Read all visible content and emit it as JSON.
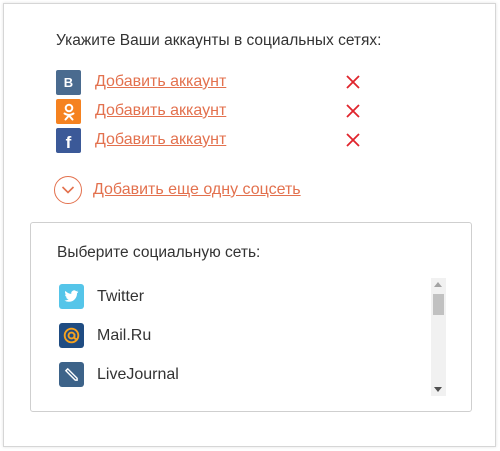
{
  "heading": "Укажите Ваши аккаунты в социальных сетях:",
  "accounts": [
    {
      "network": "vkontakte",
      "icon": "vk-icon",
      "glyph": "B",
      "color": "#4a6b8f",
      "link": "Добавить аккаунт"
    },
    {
      "network": "odnoklassniki",
      "icon": "odnoklassniki-icon",
      "glyph": "ok",
      "color": "#f58220",
      "link": "Добавить аккаунт"
    },
    {
      "network": "facebook",
      "icon": "facebook-icon",
      "glyph": "f",
      "color": "#3b5998",
      "link": "Добавить аккаунт"
    }
  ],
  "add_more": {
    "label": "Добавить еще одну соцсеть",
    "icon": "chevron-down-circle-icon"
  },
  "picker": {
    "title": "Выберите социальную сеть:",
    "items": [
      {
        "label": "Twitter",
        "icon": "twitter-icon",
        "color": "#55c5e9"
      },
      {
        "label": "Mail.Ru",
        "icon": "mailru-icon",
        "color": "#1f4c82"
      },
      {
        "label": "LiveJournal",
        "icon": "livejournal-icon",
        "color": "#3d6389"
      }
    ]
  },
  "colors": {
    "accent": "#e3714e",
    "remove": "#e0242c",
    "text": "#333333",
    "border": "#cfcfcf"
  }
}
